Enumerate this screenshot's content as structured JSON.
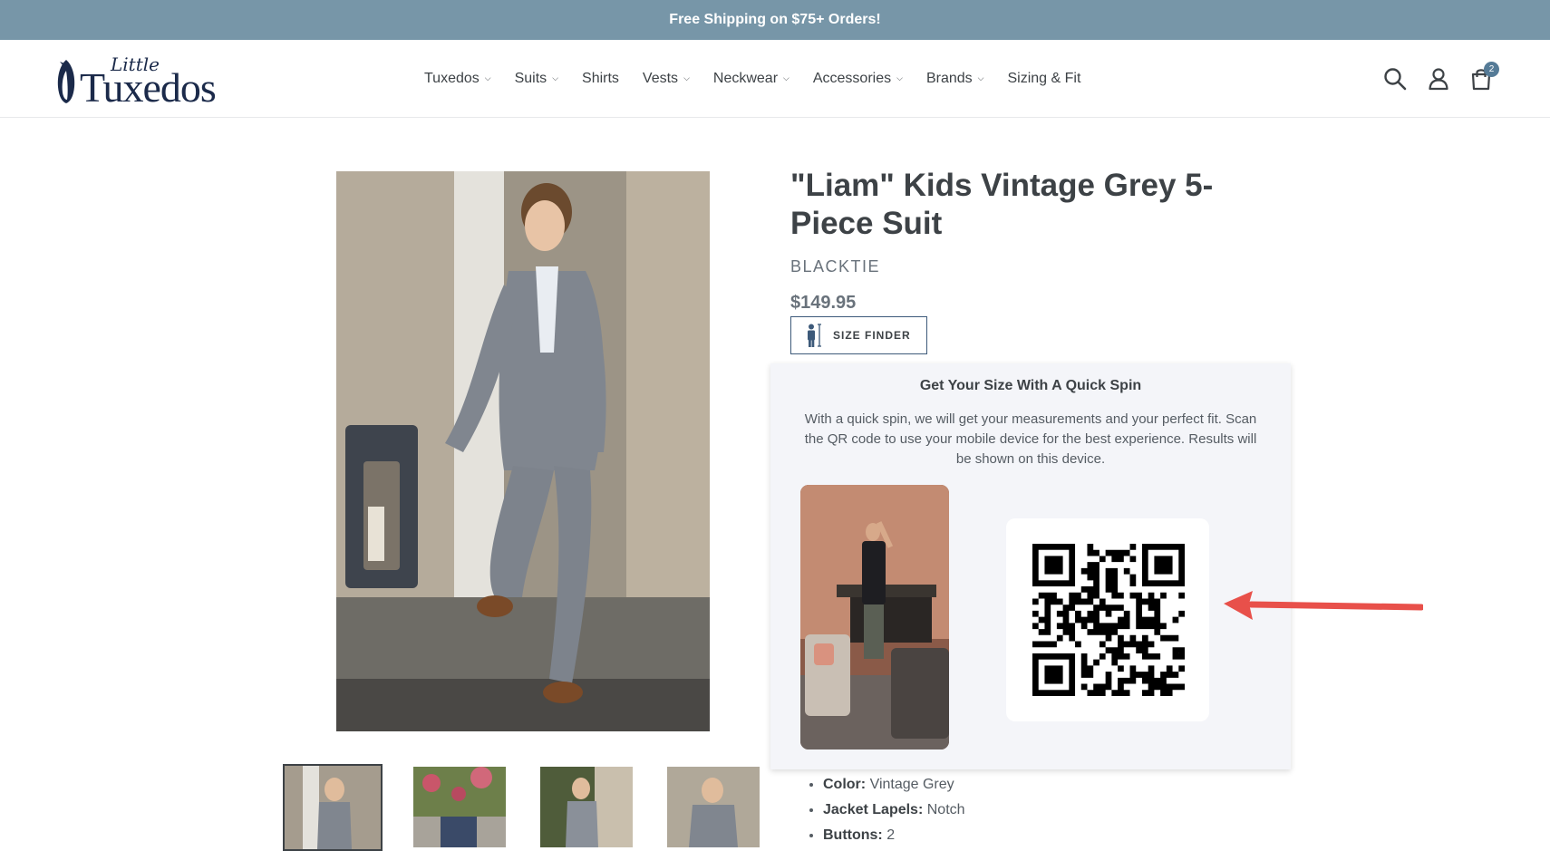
{
  "announcement": "Free Shipping on $75+ Orders!",
  "logo": {
    "small": "Little",
    "large": "Tuxedos"
  },
  "nav": [
    {
      "label": "Tuxedos",
      "dropdown": true
    },
    {
      "label": "Suits",
      "dropdown": true
    },
    {
      "label": "Shirts",
      "dropdown": false
    },
    {
      "label": "Vests",
      "dropdown": true
    },
    {
      "label": "Neckwear",
      "dropdown": true
    },
    {
      "label": "Accessories",
      "dropdown": true
    },
    {
      "label": "Brands",
      "dropdown": true
    },
    {
      "label": "Sizing & Fit",
      "dropdown": false
    }
  ],
  "header_icons": [
    "search-icon",
    "account-icon",
    "cart-icon"
  ],
  "cart_count": "2",
  "product": {
    "title": "\"Liam\" Kids Vintage Grey 5-Piece Suit",
    "vendor": "BLACKTIE",
    "price": "$149.95"
  },
  "size_finder": {
    "button_label": "SIZE FINDER",
    "popup_title": "Get Your Size With A Quick Spin",
    "popup_text": "With a quick spin, we will get your measurements and your perfect fit. Scan the QR code to use your mobile device for the best experience. Results will be shown on this device."
  },
  "specs": [
    {
      "label": "Color:",
      "value": "Vintage Grey"
    },
    {
      "label": "Jacket Lapels:",
      "value": "Notch"
    },
    {
      "label": "Buttons:",
      "value": "2"
    }
  ],
  "colors": {
    "announcement_bg": "#7796a8",
    "text": "#3d4246",
    "accent": "#557b97",
    "arrow": "#e8504a"
  }
}
